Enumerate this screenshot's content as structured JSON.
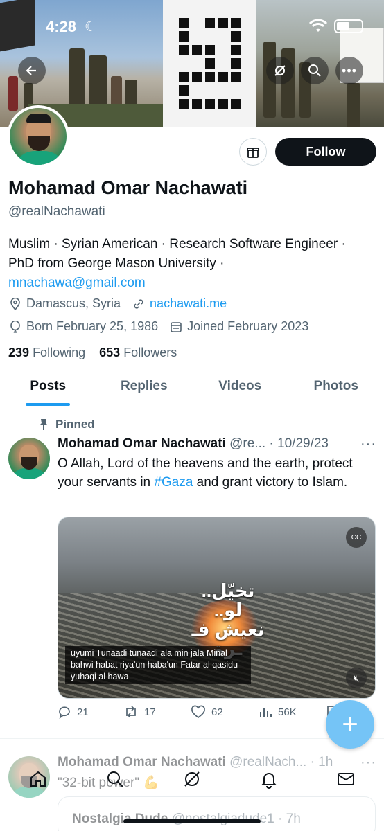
{
  "status": {
    "time": "4:28"
  },
  "profile": {
    "name": "Mohamad Omar Nachawati",
    "handle": "@realNachawati",
    "bio_line1": "Muslim · Syrian American · Research Software Engineer ·",
    "bio_line2": "PhD from George Mason University ·",
    "bio_email": "mnachawa@gmail.com",
    "location": "Damascus, Syria",
    "website": "nachawati.me",
    "born": "Born February 25, 1986",
    "joined": "Joined February 2023",
    "following_count": "239",
    "following_label": "Following",
    "followers_count": "653",
    "followers_label": "Followers",
    "follow_label": "Follow"
  },
  "tabs": [
    {
      "label": "Posts"
    },
    {
      "label": "Replies"
    },
    {
      "label": "Videos"
    },
    {
      "label": "Photos"
    }
  ],
  "tweet1": {
    "pinned_label": "Pinned",
    "author": "Mohamad Omar Nachawati",
    "handle_date": "@re... · 10/29/23",
    "text_before": "O Allah, Lord of the heavens and the earth, protect  your servants in ",
    "hashtag": "#Gaza",
    "text_after": " and grant victory to Islam.",
    "media_caption": "uyumi Tunaadi tunaadi ala min jala Minal bahwi habat riya'un haba'un Fatar al qasidu yuhaqi al hawa",
    "media_overlay_text": "تخيّل.. لو.. نعيش فـ ـرة",
    "replies": "21",
    "reposts": "17",
    "likes": "62",
    "views": "56K"
  },
  "tweet2": {
    "author": "Mohamad Omar Nachawati",
    "handle_time": "@realNach... · 1h",
    "text": "\"32-bit power\" 💪",
    "quote_author": "Nostalgia Dude",
    "quote_handle_time": "@nostalgiadude1 · 7h"
  },
  "colors": {
    "accent": "#1d9bf0",
    "text": "#0f1419",
    "muted": "#536471"
  }
}
